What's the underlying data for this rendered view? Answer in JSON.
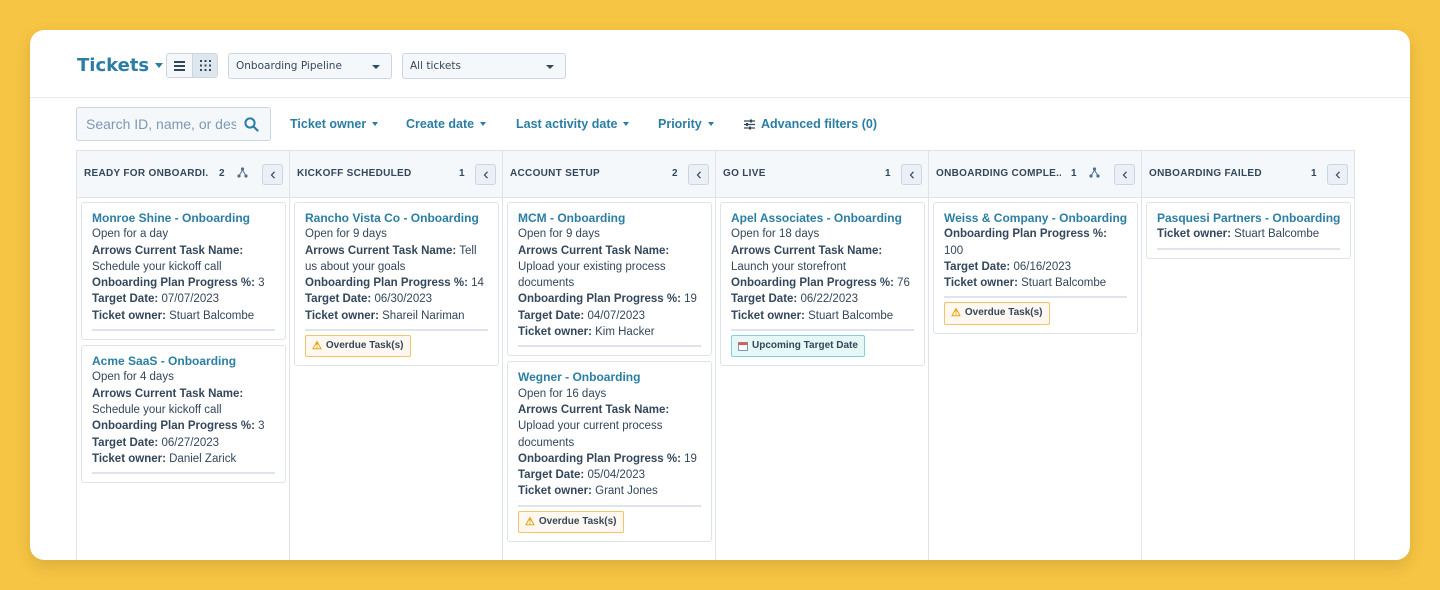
{
  "header": {
    "title": "Tickets",
    "pipeline_select": "Onboarding Pipeline",
    "view_select": "All tickets"
  },
  "filters": {
    "search_placeholder": "Search ID, name, or des",
    "items": [
      "Ticket owner",
      "Create date",
      "Last activity date",
      "Priority"
    ],
    "advanced": "Advanced filters (0)"
  },
  "columns": [
    {
      "name": "READY FOR ONBOARDI...",
      "count": "2",
      "cards": [
        {
          "title": "Monroe Shine - Onboarding",
          "open_for": "Open for a day",
          "task_label": "Arrows Current Task Name:",
          "task_value": "Schedule your kickoff call",
          "progress_label": "Onboarding Plan Progress %:",
          "progress_value": "3",
          "target_label": "Target Date:",
          "target_value": "07/07/2023",
          "owner_label": "Ticket owner:",
          "owner_value": "Stuart Balcombe"
        },
        {
          "title": "Acme SaaS - Onboarding",
          "open_for": "Open for 4 days",
          "task_label": "Arrows Current Task Name:",
          "task_value": "Schedule your kickoff call",
          "progress_label": "Onboarding Plan Progress %:",
          "progress_value": "3",
          "target_label": "Target Date:",
          "target_value": "06/27/2023",
          "owner_label": "Ticket owner:",
          "owner_value": "Daniel Zarick"
        }
      ]
    },
    {
      "name": "KICKOFF SCHEDULED",
      "count": "1",
      "cards": [
        {
          "title": "Rancho Vista Co - Onboarding",
          "open_for": "Open for 9 days",
          "task_label": "Arrows Current Task Name:",
          "task_value": "Tell us about your goals",
          "progress_label": "Onboarding Plan Progress %:",
          "progress_value": "14",
          "target_label": "Target Date:",
          "target_value": "06/30/2023",
          "owner_label": "Ticket owner:",
          "owner_value": "Shareil Nariman",
          "tag": "Overdue Task(s)"
        }
      ]
    },
    {
      "name": "ACCOUNT SETUP",
      "count": "2",
      "cards": [
        {
          "title": "MCM - Onboarding",
          "open_for": "Open for 9 days",
          "task_label": "Arrows Current Task Name:",
          "task_value": "Upload your existing process documents",
          "progress_label": "Onboarding Plan Progress %:",
          "progress_value": "19",
          "target_label": "Target Date:",
          "target_value": "04/07/2023",
          "owner_label": "Ticket owner:",
          "owner_value": "Kim Hacker"
        },
        {
          "title": "Wegner - Onboarding",
          "open_for": "Open for 16 days",
          "task_label": "Arrows Current Task Name:",
          "task_value": "Upload your current process documents",
          "progress_label": "Onboarding Plan Progress %:",
          "progress_value": "19",
          "target_label": "Target Date:",
          "target_value": "05/04/2023",
          "owner_label": "Ticket owner:",
          "owner_value": "Grant Jones",
          "tag": "Overdue Task(s)"
        }
      ]
    },
    {
      "name": "GO LIVE",
      "count": "1",
      "cards": [
        {
          "title": "Apel Associates - Onboarding",
          "open_for": "Open for 18 days",
          "task_label": "Arrows Current Task Name:",
          "task_value": "Launch your storefront",
          "progress_label": "Onboarding Plan Progress %:",
          "progress_value": "76",
          "target_label": "Target Date:",
          "target_value": "06/22/2023",
          "owner_label": "Ticket owner:",
          "owner_value": "Stuart Balcombe",
          "tag2": "Upcoming Target Date"
        }
      ]
    },
    {
      "name": "ONBOARDING COMPLE...",
      "count": "1",
      "cards": [
        {
          "title": "Weiss & Company - Onboarding",
          "progress_label": "Onboarding Plan Progress %:",
          "progress_value": "100",
          "target_label": "Target Date:",
          "target_value": "06/16/2023",
          "owner_label": "Ticket owner:",
          "owner_value": "Stuart Balcombe",
          "tag": "Overdue Task(s)"
        }
      ]
    },
    {
      "name": "ONBOARDING FAILED",
      "count": "1",
      "cards": [
        {
          "title": "Pasquesi Partners - Onboarding",
          "owner_label": "Ticket owner:",
          "owner_value": "Stuart Balcombe"
        }
      ]
    }
  ],
  "colors": {
    "background": "#f7c544",
    "link": "#2a7ea4",
    "text": "#33475b",
    "overdue_border": "#f5c26b",
    "upcoming_border": "#7fd1de"
  },
  "icons": {
    "list_view": "list-view-icon",
    "board_view": "grid-view-icon",
    "search": "search-icon",
    "advanced_filters": "sliders-icon",
    "automation": "workflow-icon",
    "collapse": "chevron-left-icon",
    "overdue": "warning-icon",
    "upcoming": "calendar-icon"
  }
}
